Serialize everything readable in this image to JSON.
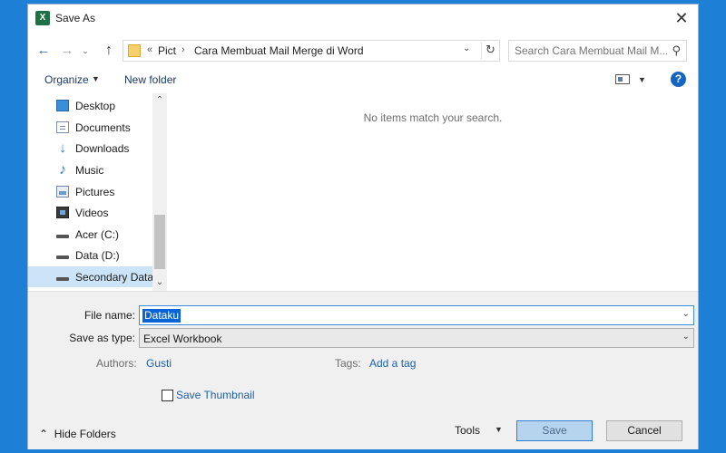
{
  "window": {
    "title": "Save As",
    "app_icon": "X"
  },
  "nav": {
    "history_label": "⌄",
    "breadcrumb_overflow": "«",
    "breadcrumb": [
      "Pict",
      "Cara Membuat Mail Merge di Word"
    ],
    "search_placeholder": "Search Cara Membuat Mail M..."
  },
  "toolbar": {
    "organize": "Organize",
    "new_folder": "New folder",
    "help": "?"
  },
  "sidebar": {
    "items": [
      {
        "label": "Desktop",
        "icon": "desktop-icon"
      },
      {
        "label": "Documents",
        "icon": "documents-icon"
      },
      {
        "label": "Downloads",
        "icon": "downloads-icon"
      },
      {
        "label": "Music",
        "icon": "music-icon"
      },
      {
        "label": "Pictures",
        "icon": "pictures-icon"
      },
      {
        "label": "Videos",
        "icon": "videos-icon"
      },
      {
        "label": "Acer (C:)",
        "icon": "drive-icon"
      },
      {
        "label": "Data  (D:)",
        "icon": "drive-icon"
      },
      {
        "label": "Secondary Data",
        "icon": "drive-icon",
        "selected": true
      }
    ]
  },
  "content": {
    "empty_message": "No items match your search."
  },
  "form": {
    "file_name_label": "File name:",
    "file_name_value": "Dataku",
    "save_type_label": "Save as type:",
    "save_type_value": "Excel Workbook",
    "authors_label": "Authors:",
    "authors_value": "Gusti",
    "tags_label": "Tags:",
    "tags_value": "Add a tag",
    "thumbnail_label": "Save Thumbnail",
    "thumbnail_checked": false
  },
  "footer": {
    "hide_folders": "Hide Folders",
    "tools": "Tools",
    "save": "Save",
    "cancel": "Cancel"
  },
  "colors": {
    "accent": "#0a64d8",
    "desktop_bg": "#1e7fd6",
    "link": "#1f5fa8"
  }
}
